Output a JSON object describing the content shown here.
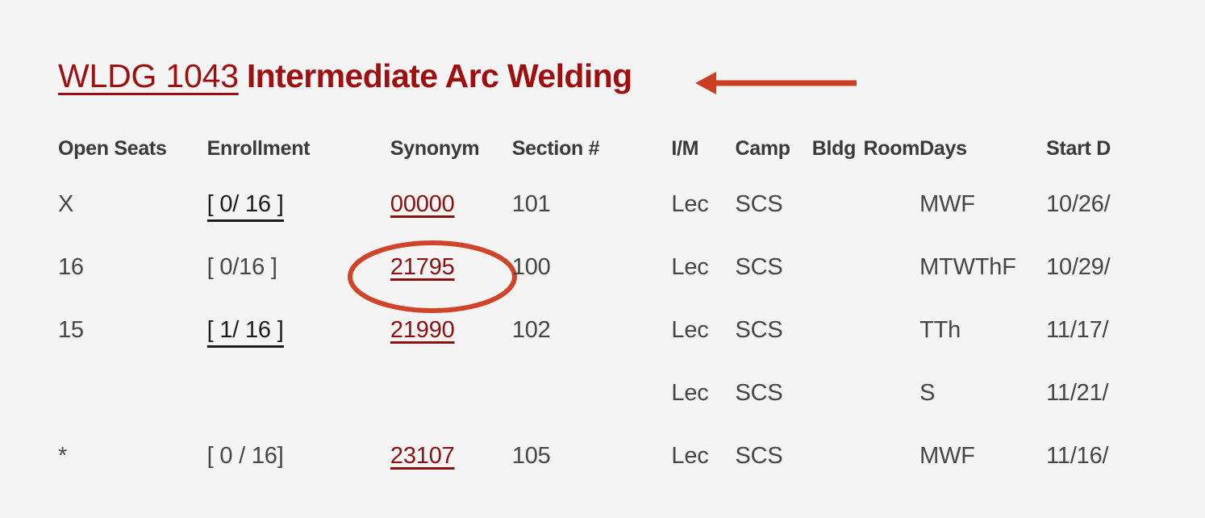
{
  "course": {
    "code": "WLDG 1043",
    "title": "Intermediate Arc Welding"
  },
  "annotations": {
    "arrow_color": "#cc3d22",
    "ellipse_color": "#d0442a",
    "arrow_target": "course-title",
    "ellipse_target": "synonym-21795"
  },
  "colors": {
    "background": "#f4f4f4",
    "heading_red": "#9e1010",
    "link_red": "#8b1111",
    "header_gray": "#3a3a3a",
    "body_gray": "#464646"
  },
  "table": {
    "headers": [
      "Open Seats",
      "Enrollment",
      "Synonym",
      "Section #",
      "I/M",
      "Camp",
      "Bldg",
      "Room",
      "Days",
      "Start D"
    ],
    "rows": [
      {
        "open_seats": "X",
        "enrollment": "[ 0/ 16 ]",
        "enrollment_underlined": true,
        "synonym": "00000",
        "section": "101",
        "im": "Lec",
        "camp": "SCS",
        "bldg": "",
        "room": "",
        "days": "MWF",
        "start_date": "10/26/"
      },
      {
        "open_seats": "16",
        "enrollment": "[ 0/16 ]",
        "enrollment_underlined": false,
        "synonym": "21795",
        "section": "100",
        "im": "Lec",
        "camp": "SCS",
        "bldg": "",
        "room": "",
        "days": "MTWThF",
        "start_date": "10/29/"
      },
      {
        "open_seats": "15",
        "enrollment": "[ 1/ 16 ]",
        "enrollment_underlined": true,
        "synonym": "21990",
        "section": "102",
        "im": "Lec",
        "camp": "SCS",
        "bldg": "",
        "room": "",
        "days": "TTh",
        "start_date": "11/17/"
      },
      {
        "open_seats": "",
        "enrollment": "",
        "enrollment_underlined": false,
        "synonym": "",
        "section": "",
        "im": "Lec",
        "camp": "SCS",
        "bldg": "",
        "room": "",
        "days": "S",
        "start_date": "11/21/"
      },
      {
        "open_seats": "*",
        "enrollment": "[ 0 / 16]",
        "enrollment_underlined": false,
        "synonym": "23107",
        "section": "105",
        "im": "Lec",
        "camp": "SCS",
        "bldg": "",
        "room": "",
        "days": "MWF",
        "start_date": "11/16/"
      }
    ]
  }
}
